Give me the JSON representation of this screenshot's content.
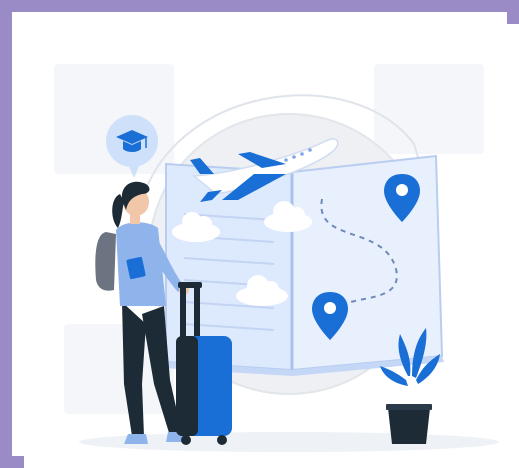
{
  "illustration": {
    "frame_color": "#9a8bc6",
    "accent": "#1a6fd6",
    "accent_light": "#cfe0fb",
    "page_fill": "#dde9fd",
    "dark": "#1d2b36",
    "icons": [
      "graduation-cap-icon",
      "airplane-icon",
      "location-pin-icon",
      "suitcase-icon",
      "plant-icon",
      "cloud-icon"
    ]
  }
}
